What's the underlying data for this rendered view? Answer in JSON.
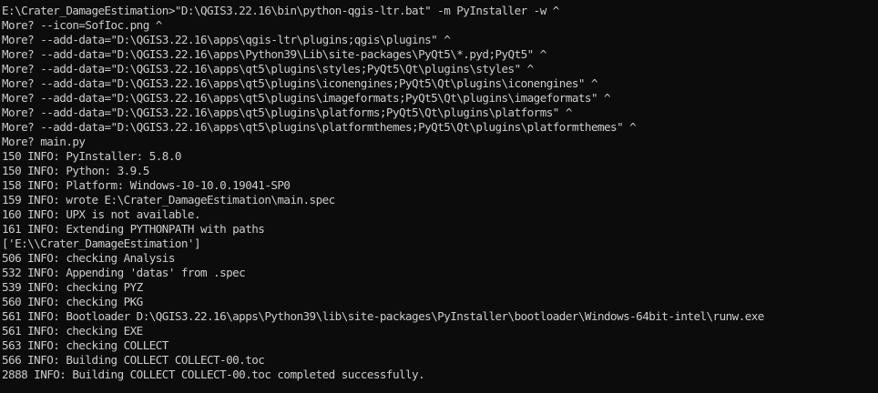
{
  "colors": {
    "background": "#0c0c0c",
    "foreground": "#cccccc"
  },
  "console": {
    "lines": [
      "E:\\Crater_DamageEstimation>\"D:\\QGIS3.22.16\\bin\\python-qgis-ltr.bat\" -m PyInstaller -w ^",
      "More? --icon=SofIoc.png ^",
      "More? --add-data=\"D:\\QGIS3.22.16\\apps\\qgis-ltr\\plugins;qgis\\plugins\" ^",
      "More? --add-data=\"D:\\QGIS3.22.16\\apps\\Python39\\Lib\\site-packages\\PyQt5\\*.pyd;PyQt5\" ^",
      "More? --add-data=\"D:\\QGIS3.22.16\\apps\\qt5\\plugins\\styles;PyQt5\\Qt\\plugins\\styles\" ^",
      "More? --add-data=\"D:\\QGIS3.22.16\\apps\\qt5\\plugins\\iconengines;PyQt5\\Qt\\plugins\\iconengines\" ^",
      "More? --add-data=\"D:\\QGIS3.22.16\\apps\\qt5\\plugins\\imageformats;PyQt5\\Qt\\plugins\\imageformats\" ^",
      "More? --add-data=\"D:\\QGIS3.22.16\\apps\\qt5\\plugins\\platforms;PyQt5\\Qt\\plugins\\platforms\" ^",
      "More? --add-data=\"D:\\QGIS3.22.16\\apps\\qt5\\plugins\\platformthemes;PyQt5\\Qt\\plugins\\platformthemes\" ^",
      "More? main.py",
      "150 INFO: PyInstaller: 5.8.0",
      "150 INFO: Python: 3.9.5",
      "158 INFO: Platform: Windows-10-10.0.19041-SP0",
      "159 INFO: wrote E:\\Crater_DamageEstimation\\main.spec",
      "160 INFO: UPX is not available.",
      "161 INFO: Extending PYTHONPATH with paths",
      "['E:\\\\Crater_DamageEstimation']",
      "506 INFO: checking Analysis",
      "532 INFO: Appending 'datas' from .spec",
      "539 INFO: checking PYZ",
      "560 INFO: checking PKG",
      "561 INFO: Bootloader D:\\QGIS3.22.16\\apps\\Python39\\lib\\site-packages\\PyInstaller\\bootloader\\Windows-64bit-intel\\runw.exe",
      "561 INFO: checking EXE",
      "563 INFO: checking COLLECT",
      "566 INFO: Building COLLECT COLLECT-00.toc",
      "2888 INFO: Building COLLECT COLLECT-00.toc completed successfully."
    ]
  }
}
